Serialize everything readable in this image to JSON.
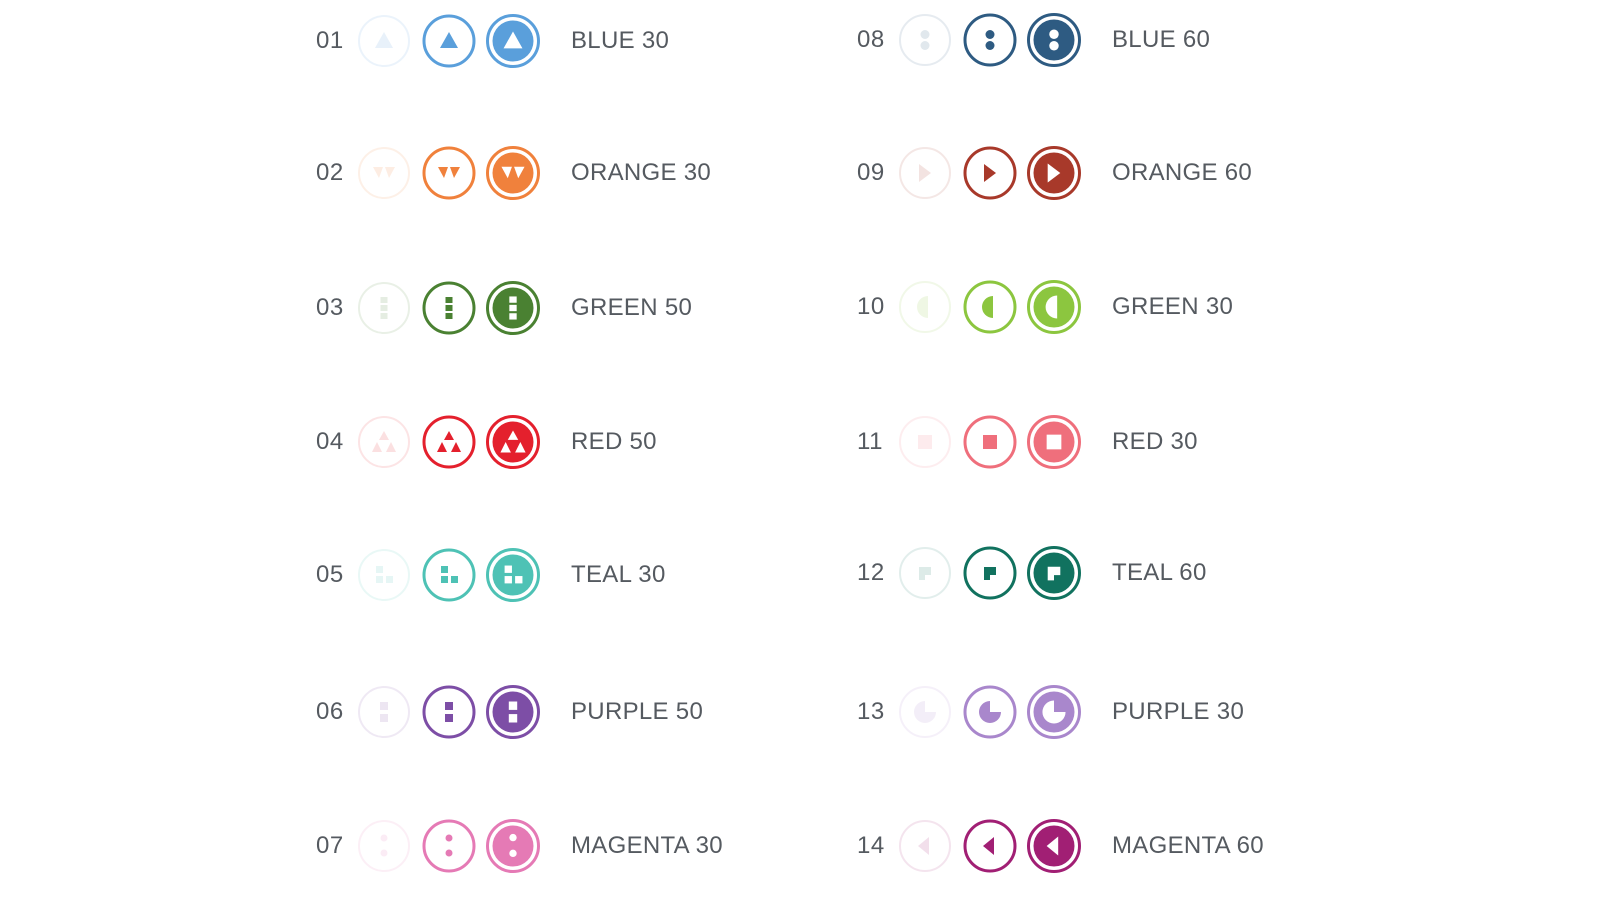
{
  "legend": {
    "rows": [
      {
        "number": "01",
        "name": "BLUE 30",
        "color": "#5a9fdb",
        "icon": "triangle-up-icon"
      },
      {
        "number": "02",
        "name": "ORANGE 30",
        "color": "#f0813c",
        "icon": "double-down-triangle-icon"
      },
      {
        "number": "03",
        "name": "GREEN 50",
        "color": "#4a8132",
        "icon": "vertical-dash-bars-icon"
      },
      {
        "number": "04",
        "name": "RED 50",
        "color": "#e4202d",
        "icon": "triangle-trio-icon"
      },
      {
        "number": "05",
        "name": "TEAL 30",
        "color": "#4ec2b5",
        "icon": "square-grid-icon"
      },
      {
        "number": "06",
        "name": "PURPLE 50",
        "color": "#7d4ea6",
        "icon": "stacked-squares-icon"
      },
      {
        "number": "07",
        "name": "MAGENTA 30",
        "color": "#e57ab5",
        "icon": "vertical-dots-icon"
      },
      {
        "number": "08",
        "name": "BLUE 60",
        "color": "#2e5b82",
        "icon": "two-dots-icon"
      },
      {
        "number": "09",
        "name": "ORANGE 60",
        "color": "#a8392a",
        "icon": "bowtie-triangles-icon"
      },
      {
        "number": "10",
        "name": "GREEN 30",
        "color": "#8cc63f",
        "icon": "half-circle-icon"
      },
      {
        "number": "11",
        "name": "RED 30",
        "color": "#ef6f7c",
        "icon": "square-icon"
      },
      {
        "number": "12",
        "name": "TEAL 60",
        "color": "#11725f",
        "icon": "flag-block-icon"
      },
      {
        "number": "13",
        "name": "PURPLE 30",
        "color": "#a987cc",
        "icon": "pie-three-quarter-icon"
      },
      {
        "number": "14",
        "name": "MAGENTA 60",
        "color": "#a11f74",
        "icon": "triangle-left-icon"
      }
    ]
  }
}
